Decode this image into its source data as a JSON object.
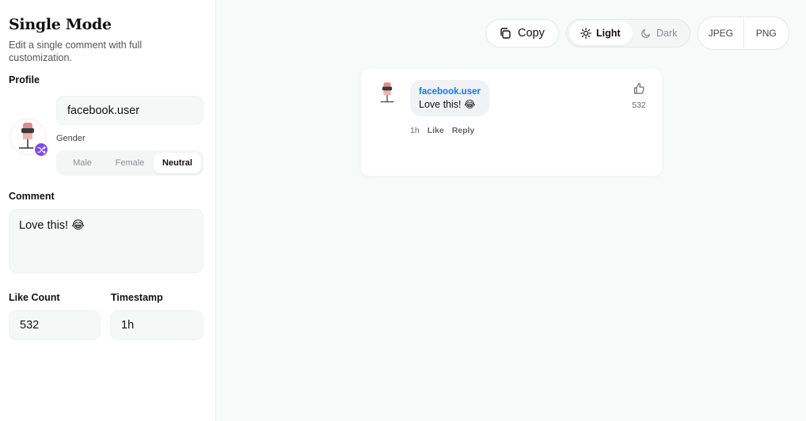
{
  "sidebar": {
    "title": "Single Mode",
    "subtitle": "Edit a single comment with full customization.",
    "profile_label": "Profile",
    "username": "facebook.user",
    "gender_label": "Gender",
    "gender_options": [
      "Male",
      "Female",
      "Neutral"
    ],
    "gender_selected": "Neutral",
    "comment_label": "Comment",
    "comment_text": "Love this! 😂",
    "like_count_label": "Like Count",
    "like_count": "532",
    "timestamp_label": "Timestamp",
    "timestamp": "1h"
  },
  "toolbar": {
    "copy_label": "Copy",
    "theme_light": "Light",
    "theme_dark": "Dark",
    "theme_selected": "Light",
    "export_jpeg": "JPEG",
    "export_png": "PNG"
  },
  "preview": {
    "name": "facebook.user",
    "text": "Love this! 😂",
    "time": "1h",
    "like_action": "Like",
    "reply_action": "Reply",
    "likes": "532",
    "name_color": "#1877f2",
    "bubble_color": "#f0f2f5"
  },
  "icons": {
    "shuffle": "shuffle-icon",
    "copy": "copy-icon",
    "sun": "sun-icon",
    "moon": "moon-icon",
    "thumbs_up": "thumbs-up-icon"
  },
  "colors": {
    "accent": "#7c4ce6",
    "link": "#1877f2"
  }
}
